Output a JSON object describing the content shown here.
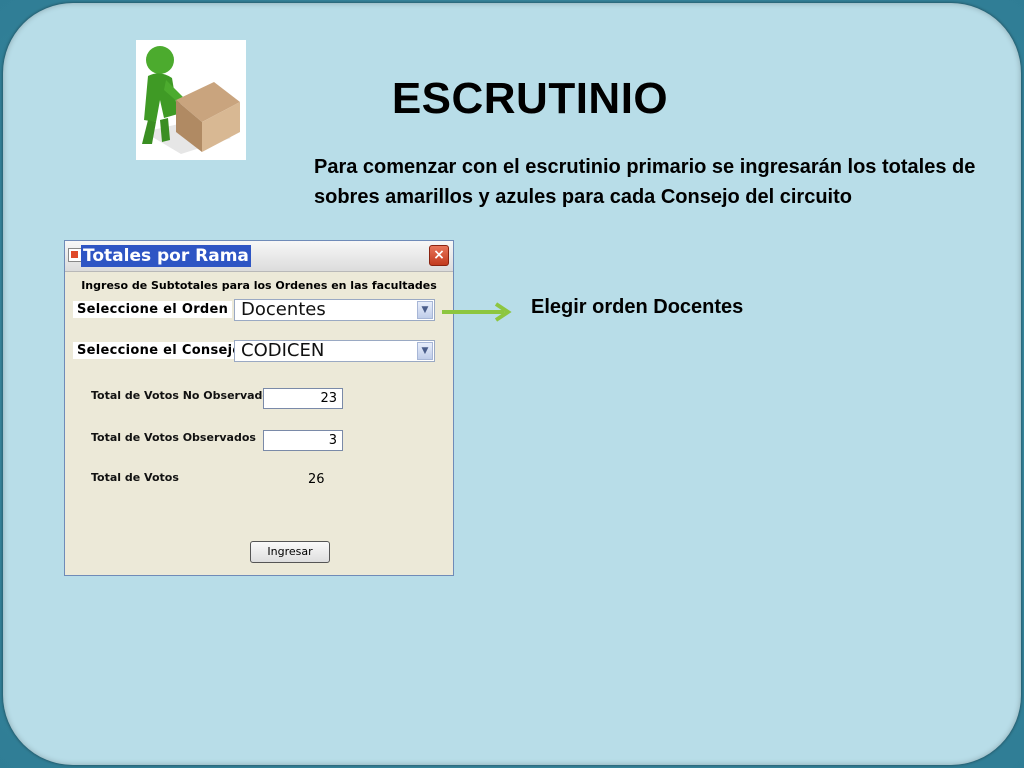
{
  "slide": {
    "title": "ESCRUTINIO",
    "description": "Para comenzar con el escrutinio primario se ingresarán los totales de sobres amarillos y azules para cada Consejo del circuito",
    "arrow_label": "Elegir orden Docentes",
    "clipart_icon": "person-carrying-box-icon"
  },
  "window": {
    "title": "Totales por  Rama",
    "close_symbol": "×",
    "heading": "Ingreso de Subtotales para los Ordenes en las facultades",
    "orden": {
      "label": "Seleccione el Orden",
      "value": "Docentes"
    },
    "consejo": {
      "label": "Seleccione el Consejo",
      "value": "CODICEN"
    },
    "no_observados": {
      "label": "Total de Votos No Observados",
      "value": "23"
    },
    "observados": {
      "label": "Total de Votos Observados",
      "value": "3"
    },
    "total": {
      "label": "Total de Votos",
      "value": "26"
    },
    "submit_label": "Ingresar",
    "dropdown_symbol": "▼"
  },
  "colors": {
    "panel": "#b8dde8",
    "frame": "#3f8fa6",
    "titlebar_highlight": "#2e55c4",
    "arrow": "#8dc63f",
    "person": "#4cab2e"
  }
}
